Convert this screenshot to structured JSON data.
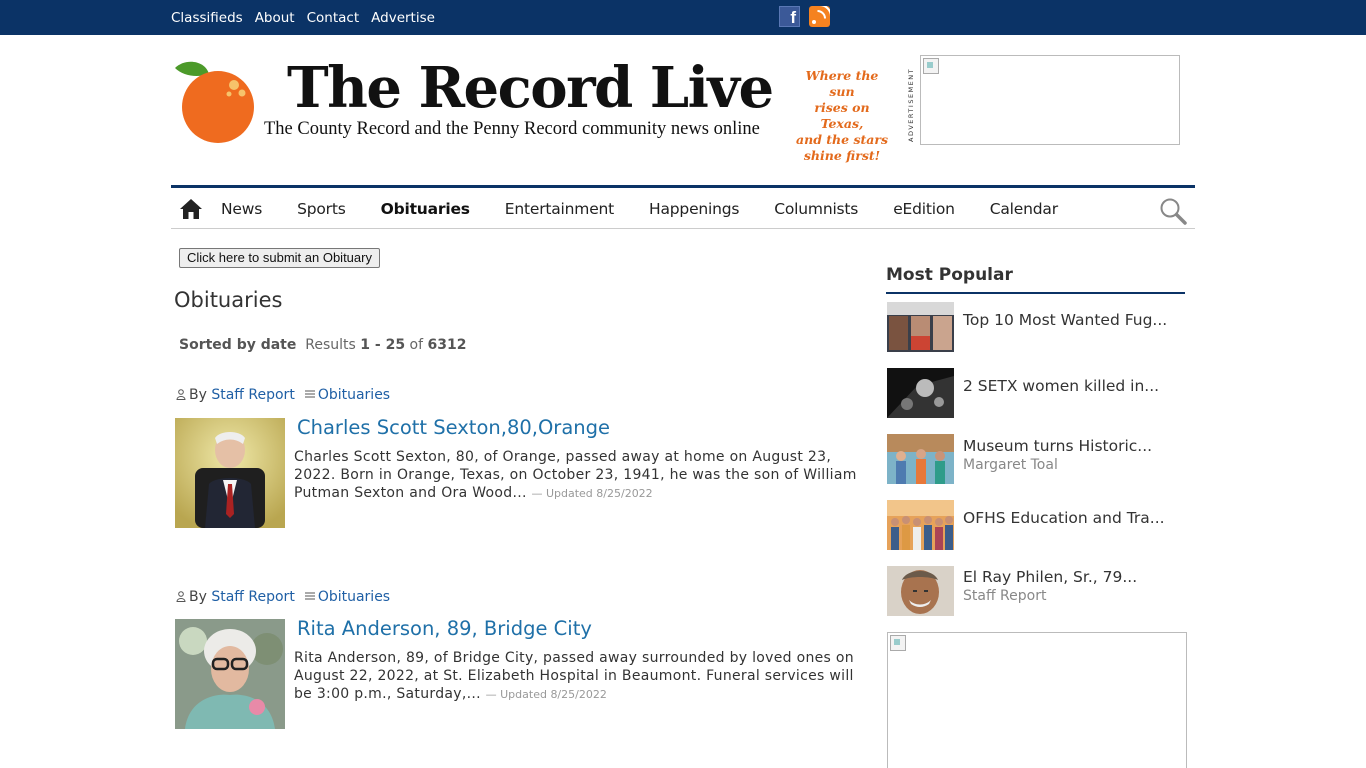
{
  "topbar": {
    "links": [
      "Classifieds",
      "About",
      "Contact",
      "Advertise"
    ],
    "icons": [
      "facebook-icon",
      "rss-icon"
    ],
    "color": "#0b3366"
  },
  "masthead": {
    "title": "The Record Live",
    "subtitle": "The County Record and the Penny Record community news online",
    "tagline_lines": [
      "Where the sun",
      "rises on Texas,",
      "and the stars",
      "shine first!"
    ],
    "ad_label": "ADVERTISEMENT"
  },
  "nav": {
    "items": [
      "News",
      "Sports",
      "Obituaries",
      "Entertainment",
      "Happenings",
      "Columnists",
      "eEdition",
      "Calendar"
    ],
    "active": "Obituaries"
  },
  "content": {
    "submit_button": "Click here to submit an Obituary",
    "page_title": "Obituaries",
    "sort_label": "Sorted by date",
    "results_prefix": "Results",
    "results_range": "1 - 25",
    "results_of": "of",
    "results_total": "6312"
  },
  "articles": [
    {
      "by_prefix": "By",
      "author": "Staff Report",
      "section": "Obituaries",
      "headline": "Charles Scott Sexton,80,Orange",
      "summary": "Charles Scott Sexton, 80, of Orange, passed away at home on August 23, 2022. Born in Orange, Texas, on October 23, 1941, he was the son of William Putman Sexton and Ora Wood...",
      "updated": "— Updated 8/25/2022"
    },
    {
      "by_prefix": "By",
      "author": "Staff Report",
      "section": "Obituaries",
      "headline": "Rita Anderson, 89, Bridge City",
      "summary": "Rita Anderson, 89, of Bridge City, passed away surrounded by loved ones on August 22, 2022, at St. Elizabeth Hospital in Beaumont. Funeral services will be 3:00 p.m., Saturday,...",
      "updated": "— Updated 8/25/2022"
    }
  ],
  "sidebar": {
    "title": "Most Popular",
    "items": [
      {
        "title": "Top 10 Most Wanted Fug...",
        "author": ""
      },
      {
        "title": "2 SETX women killed in...",
        "author": ""
      },
      {
        "title": "Museum turns Historic...",
        "author": "Margaret Toal"
      },
      {
        "title": "OFHS Education and Tra...",
        "author": ""
      },
      {
        "title": "El Ray Philen, Sr., 79...",
        "author": "Staff Report"
      }
    ]
  }
}
